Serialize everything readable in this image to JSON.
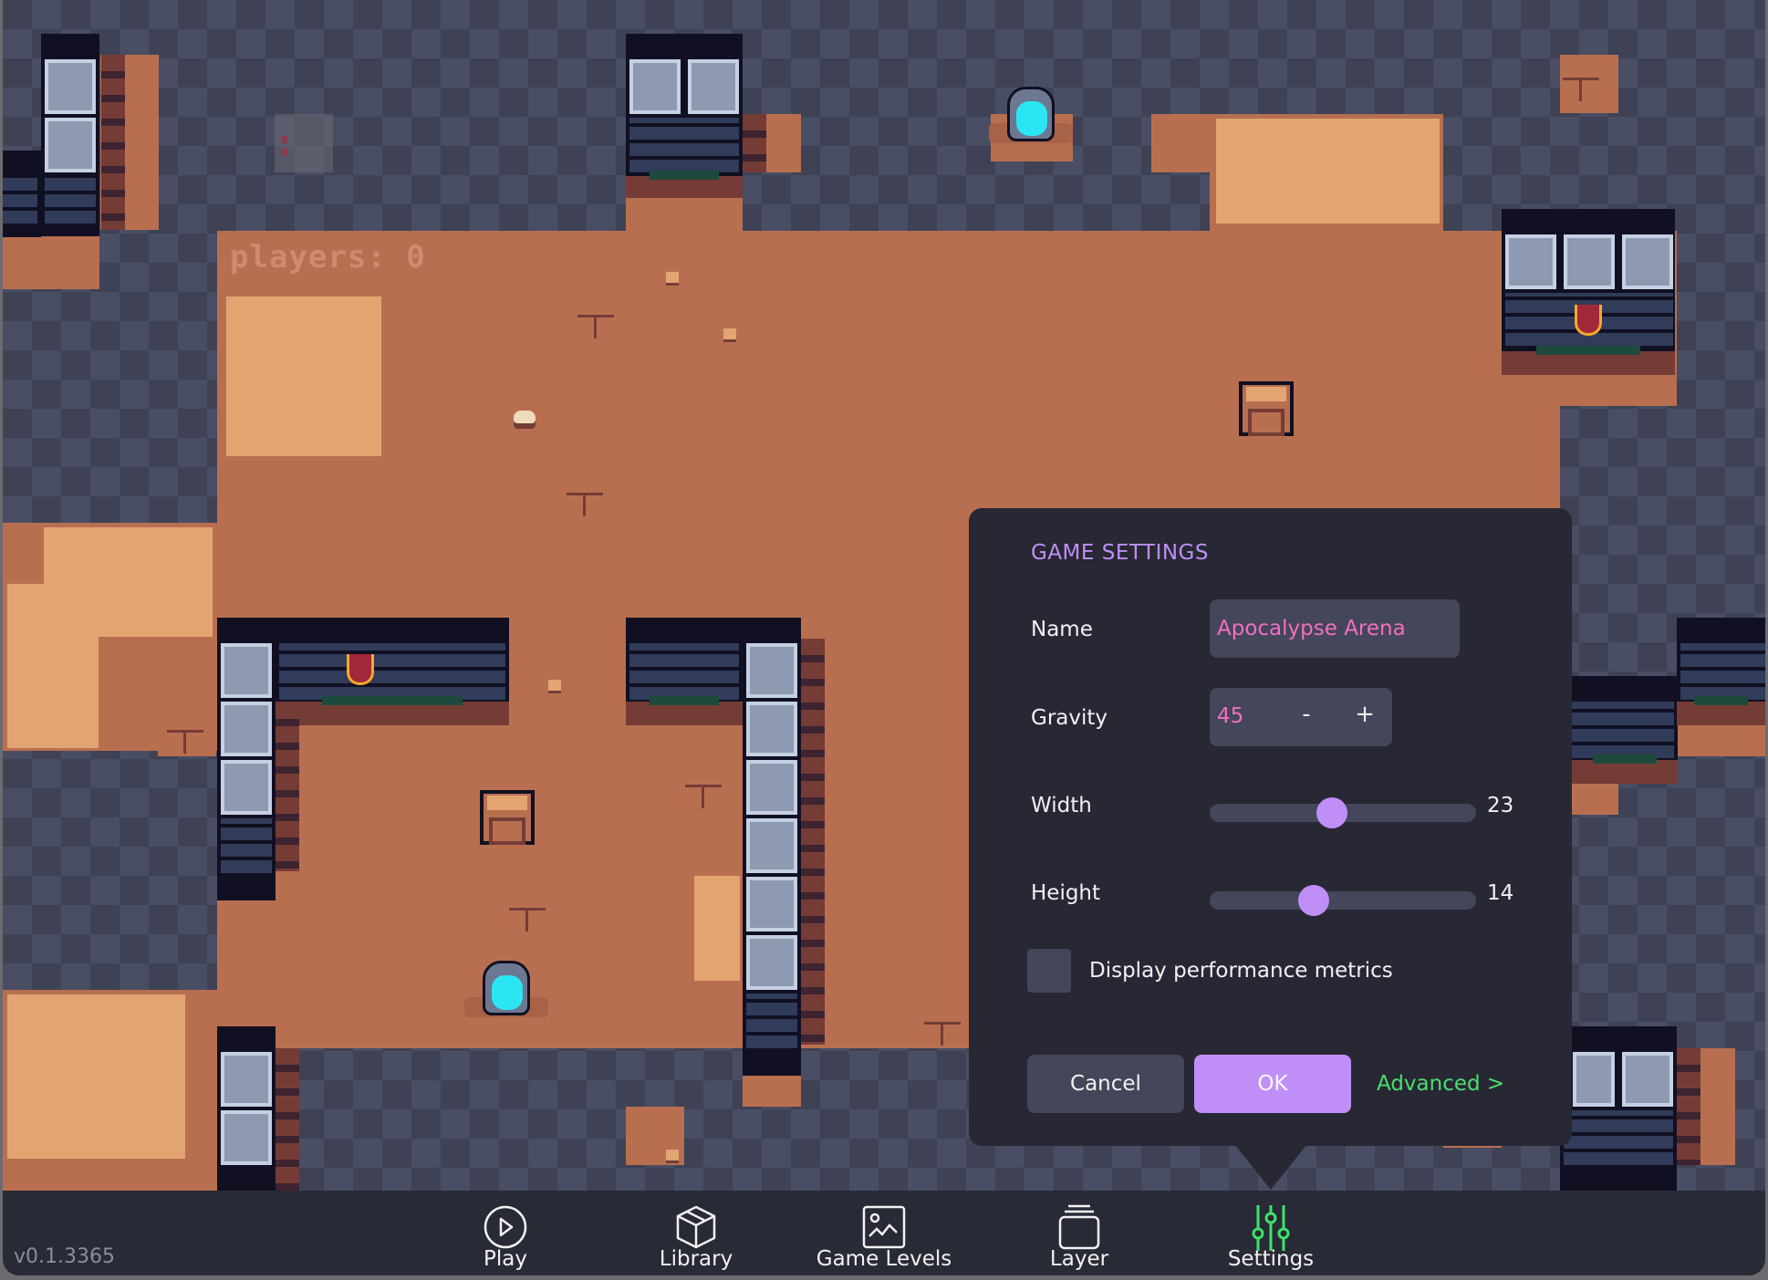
{
  "hud": {
    "players_label": "players: 0"
  },
  "settings": {
    "title": "GAME SETTINGS",
    "name": {
      "label": "Name",
      "value": "Apocalypse Arena"
    },
    "gravity": {
      "label": "Gravity",
      "value": "45",
      "decrement": "-",
      "increment": "+"
    },
    "width": {
      "label": "Width",
      "value": "23",
      "fraction": 0.46
    },
    "height": {
      "label": "Height",
      "value": "14",
      "fraction": 0.39
    },
    "performance_metrics": {
      "label": "Display performance metrics",
      "checked": false
    },
    "cancel_label": "Cancel",
    "ok_label": "OK",
    "advanced_label": "Advanced >"
  },
  "bottom_bar": {
    "version": "v0.1.3365",
    "tabs": [
      {
        "label": "Play",
        "icon": "play-circle-icon"
      },
      {
        "label": "Library",
        "icon": "cube-icon"
      },
      {
        "label": "Game Levels",
        "icon": "image-icon"
      },
      {
        "label": "Layer",
        "icon": "layers-icon"
      },
      {
        "label": "Settings",
        "icon": "sliders-icon",
        "active": true
      }
    ]
  },
  "colors": {
    "accent_purple": "#bf8ff7",
    "value_pink": "#f16fbf",
    "link_green": "#4ade6e",
    "panel_bg": "#272834",
    "floor_dirt": "#b86f50",
    "floor_sand": "#e2a572"
  }
}
